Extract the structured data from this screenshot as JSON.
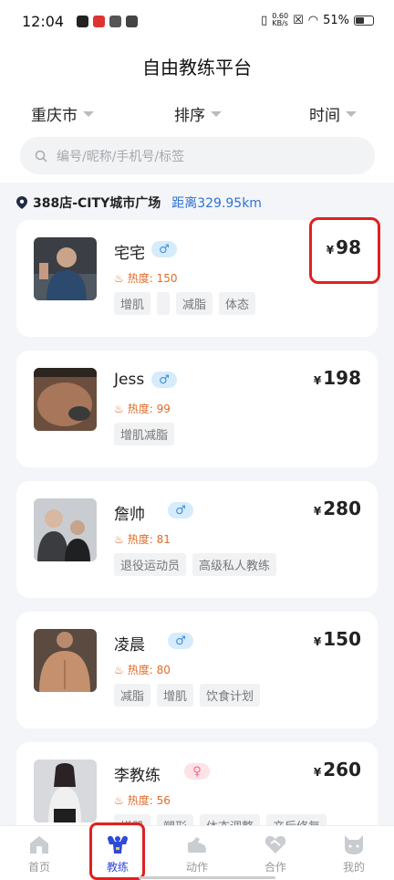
{
  "status_bar": {
    "time": "12:04",
    "network_speed": "0.60",
    "network_unit": "KB/s",
    "battery": "51%"
  },
  "header": {
    "title": "自由教练平台"
  },
  "filters": [
    {
      "label": "重庆市"
    },
    {
      "label": "排序"
    },
    {
      "label": "时间"
    }
  ],
  "search": {
    "placeholder": "编号/昵称/手机号/标签"
  },
  "location": {
    "name": "388店-CITY城市广场",
    "distance": "距离329.95km"
  },
  "coaches": [
    {
      "name": "宅宅",
      "gender": "male",
      "gender_symbol": "♂",
      "heat": "热度: 150",
      "price_symbol": "¥",
      "price": "98",
      "tags": [
        "增肌",
        "",
        "减脂",
        "体态"
      ]
    },
    {
      "name": "Jess",
      "gender": "male",
      "gender_symbol": "♂",
      "heat": "热度: 99",
      "price_symbol": "¥",
      "price": "198",
      "tags": [
        "增肌减脂"
      ]
    },
    {
      "name": "詹帅",
      "gender": "male",
      "gender_symbol": "♂",
      "heat": "热度: 81",
      "price_symbol": "¥",
      "price": "280",
      "tags": [
        "退役运动员",
        "高级私人教练"
      ]
    },
    {
      "name": "凌晨",
      "gender": "male",
      "gender_symbol": "♂",
      "heat": "热度: 80",
      "price_symbol": "¥",
      "price": "150",
      "tags": [
        "减脂",
        "增肌",
        "饮食计划"
      ]
    },
    {
      "name": "李教练",
      "gender": "female",
      "gender_symbol": "♀",
      "heat": "热度: 56",
      "price_symbol": "¥",
      "price": "260",
      "tags": [
        "增肌",
        "塑形",
        "体态调整",
        "产后修复"
      ]
    }
  ],
  "tabbar": [
    {
      "label": "首页",
      "icon": "home-icon"
    },
    {
      "label": "教练",
      "icon": "muscle-icon",
      "active": true
    },
    {
      "label": "动作",
      "icon": "shoe-icon"
    },
    {
      "label": "合作",
      "icon": "handshake-icon"
    },
    {
      "label": "我的",
      "icon": "cat-icon"
    }
  ],
  "colors": {
    "accent": "#2e4bd8",
    "highlight": "#e02020",
    "distance": "#2e72d2",
    "heat": "#e06b2a"
  }
}
